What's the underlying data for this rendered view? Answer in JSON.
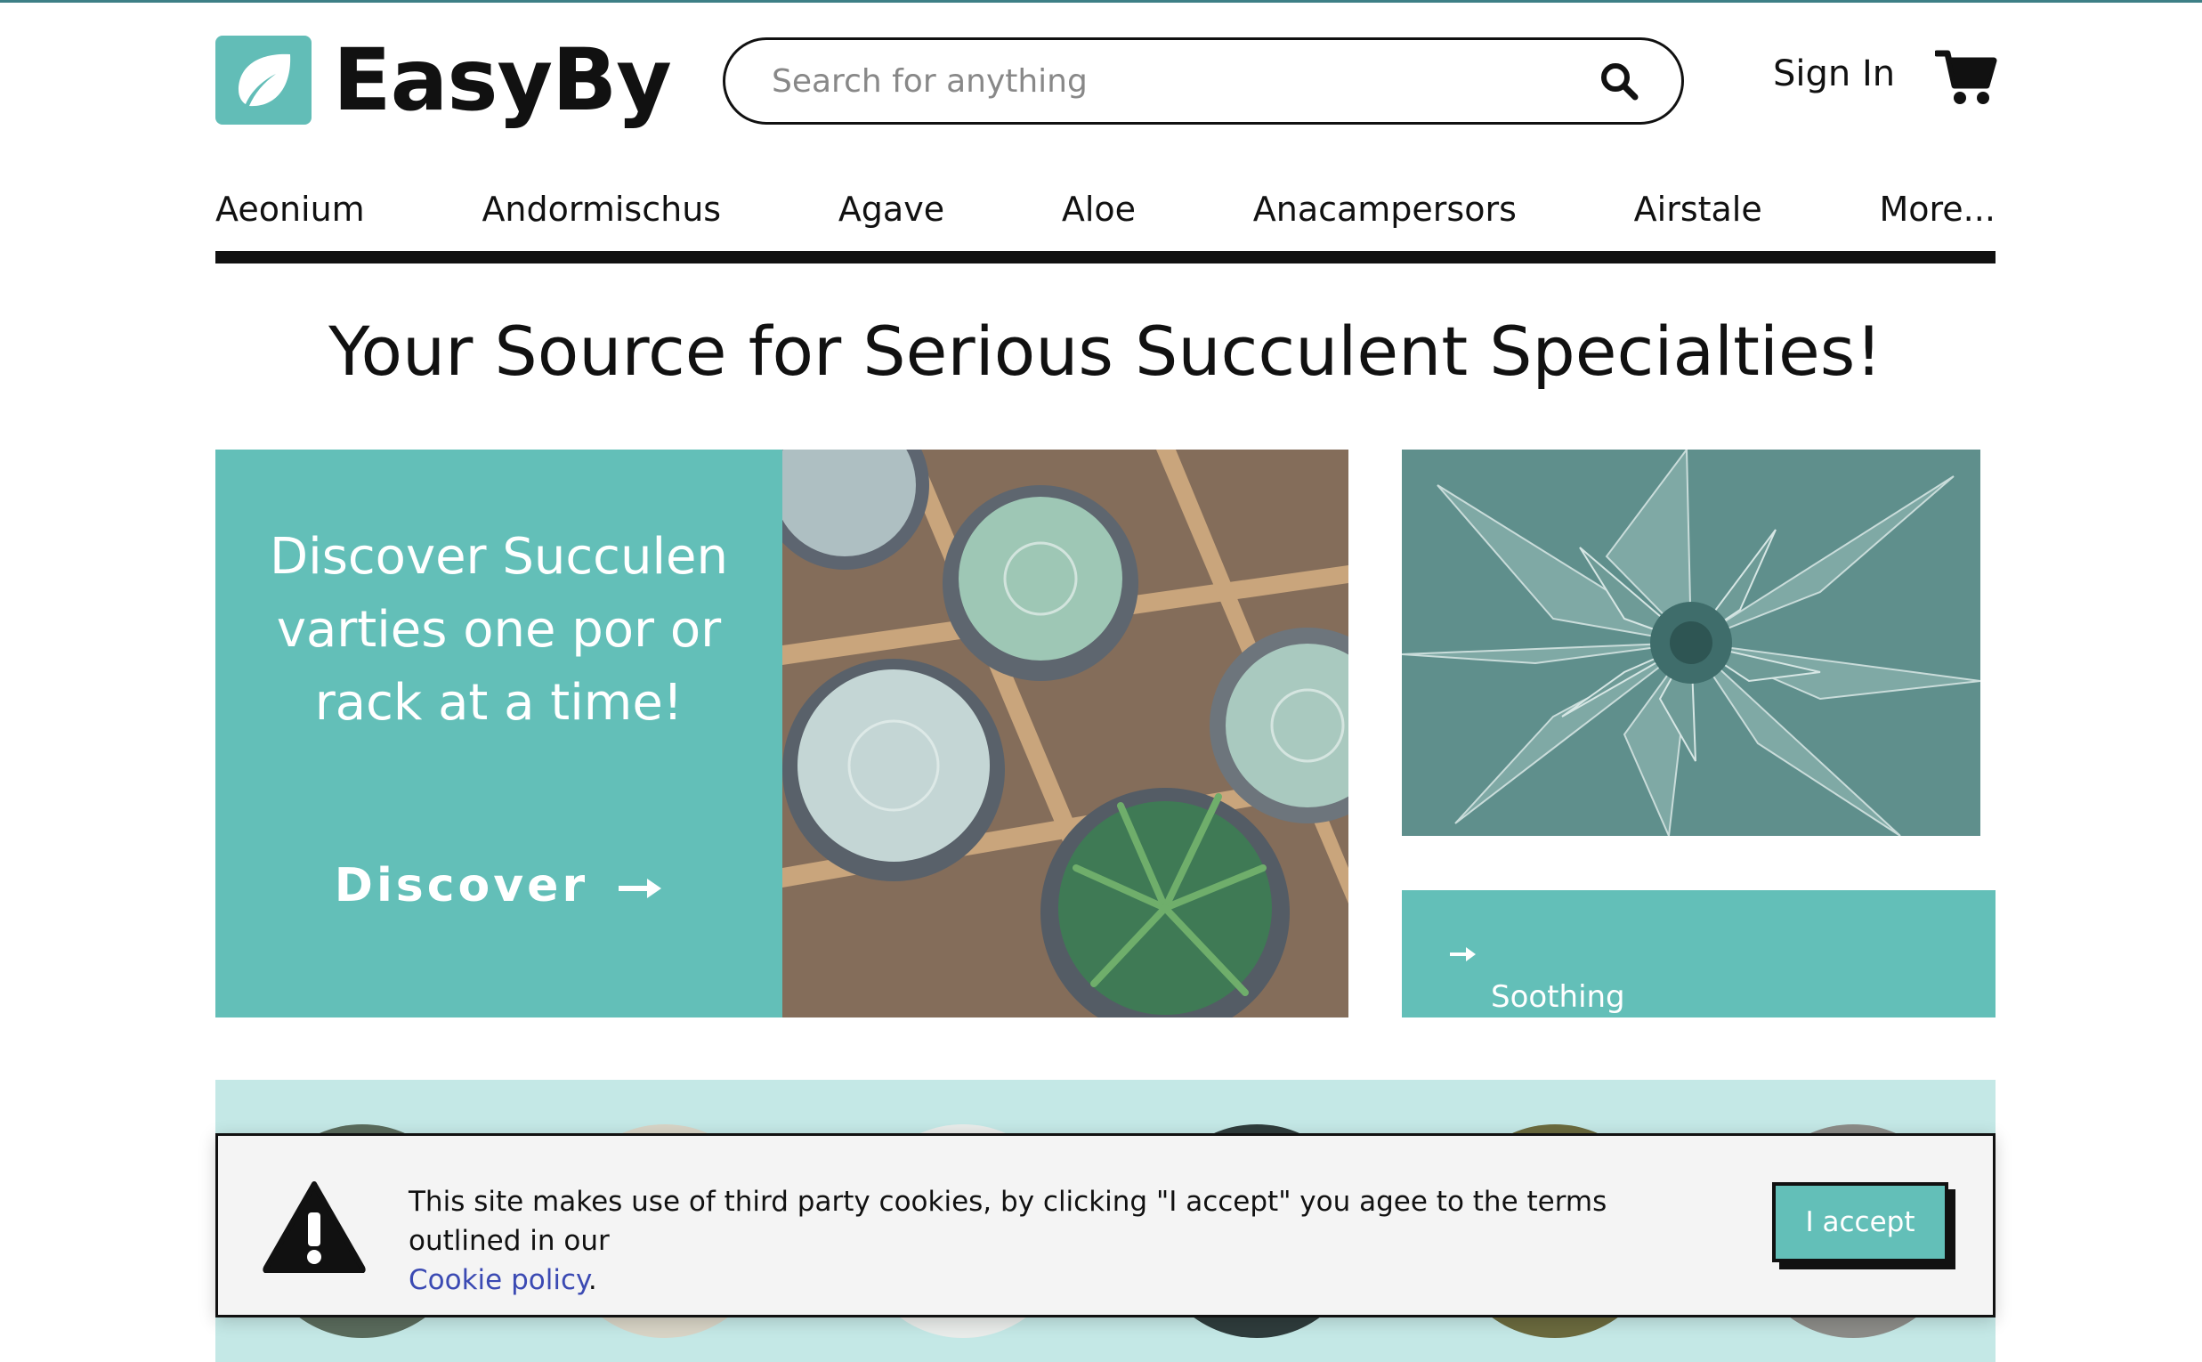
{
  "brand": {
    "name": "EasyBy",
    "accent_color": "#63bfb8",
    "topline_color": "#3d7f86"
  },
  "header": {
    "search_placeholder": "Search for anything",
    "sign_in_label": "Sign In",
    "cart_icon": "cart-icon"
  },
  "nav": {
    "items": [
      {
        "label": "Aeonium"
      },
      {
        "label": "Andormischus"
      },
      {
        "label": "Agave"
      },
      {
        "label": "Aloe"
      },
      {
        "label": "Anacampersors"
      },
      {
        "label": "Airstale"
      },
      {
        "label": "More..."
      }
    ]
  },
  "main": {
    "headline": "Your Source for Serious Succulent Specialties!",
    "hero": {
      "copy": "Discover Succulen varties one por or rack at a time!",
      "cta_label": "Discover",
      "cta_icon": "arrow-right-icon"
    },
    "aloe_card": {
      "label": "Soothing Aloe",
      "icon": "arrow-right-icon"
    }
  },
  "cookie_banner": {
    "icon": "warning-icon",
    "message": "This site makes use of third party cookies, by clicking \"I accept\" you agee to the terms outlined in our",
    "link_label": "Cookie policy",
    "trailing": ".",
    "accept_label": "I accept"
  }
}
